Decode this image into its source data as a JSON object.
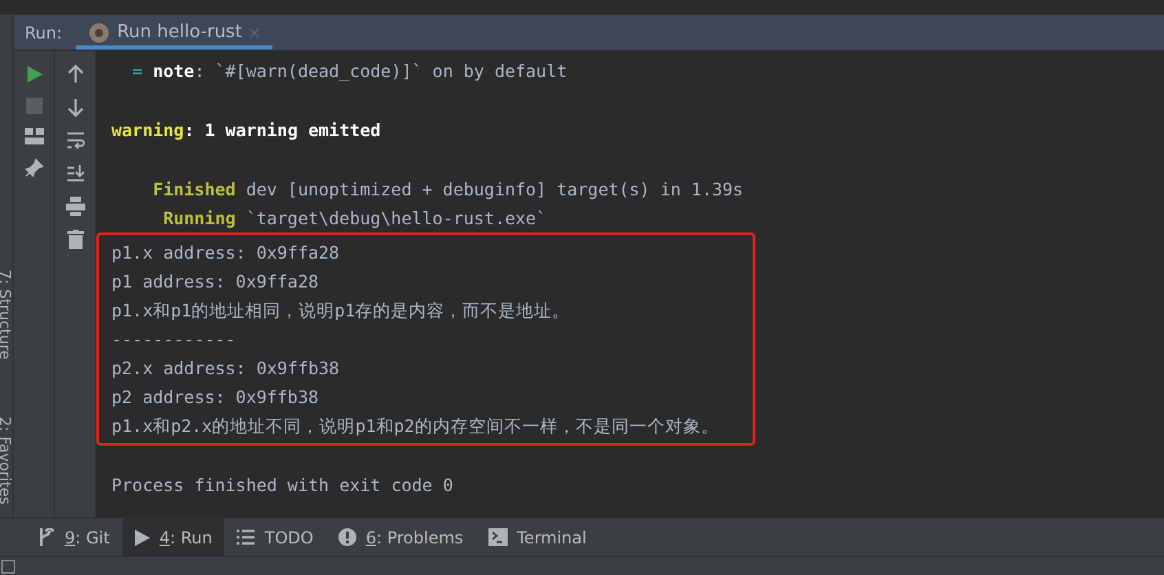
{
  "side_labels": [
    "7: Structure",
    "2: Favorites"
  ],
  "run_panel": {
    "label": "Run:",
    "tabs": [
      {
        "title": "Run hello-rust",
        "selected": true
      }
    ]
  },
  "console": {
    "lines": [
      {
        "kind": "note",
        "prefix": "=",
        "label": "note",
        "text": ": `#[warn(dead_code)]` on by default"
      },
      {
        "kind": "warning",
        "label": "warning",
        "text": ": 1 warning emitted"
      },
      {
        "kind": "cargo",
        "label": "Finished",
        "text": " dev [unoptimized + debuginfo] target(s) in 1.39s"
      },
      {
        "kind": "cargo",
        "label": "Running",
        "text": " `target\\debug\\hello-rust.exe`"
      }
    ],
    "highlighted_output": [
      "p1.x address: 0x9ffa28",
      "p1 address: 0x9ffa28",
      "p1.x和p1的地址相同，说明p1存的是内容，而不是地址。",
      "------------",
      "p2.x address: 0x9ffb38",
      "p2 address: 0x9ffb38",
      "p1.x和p2.x的地址不同，说明p1和p2的内存空间不一样，不是同一个对象。"
    ],
    "exit_message": "Process finished with exit code 0"
  },
  "tool_tabs": [
    {
      "kind": "git",
      "mnemonic": "9",
      "label": ": Git",
      "selected": false
    },
    {
      "kind": "run",
      "mnemonic": "4",
      "label": ": Run",
      "selected": true
    },
    {
      "kind": "list",
      "label": "TODO",
      "selected": false
    },
    {
      "kind": "problems",
      "mnemonic": "6",
      "label": ": Problems",
      "selected": false
    },
    {
      "kind": "terminal",
      "label": "Terminal",
      "selected": false
    }
  ]
}
